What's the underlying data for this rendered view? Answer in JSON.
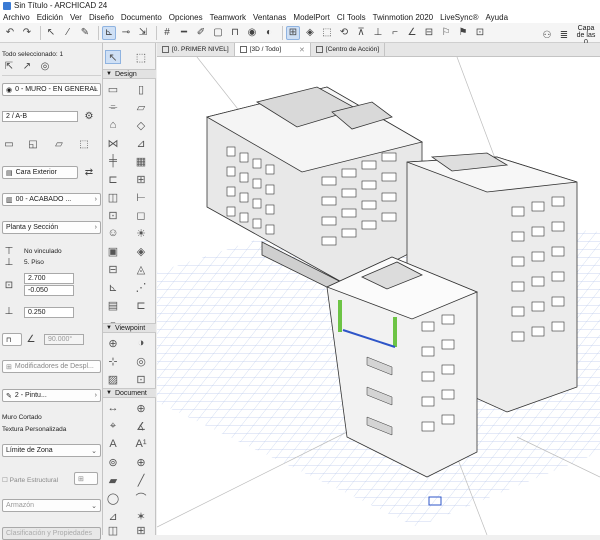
{
  "title": "Sin Título - ARCHICAD 24",
  "menu": [
    "Archivo",
    "Edición",
    "Ver",
    "Diseño",
    "Documento",
    "Opciones",
    "Teamwork",
    "Ventanas",
    "ModelPort",
    "CI Tools",
    "Twinmotion 2020",
    "LiveSync®",
    "Ayuda"
  ],
  "toolbar": {
    "layer_label": "Capa de las",
    "layer_value": "0"
  },
  "info": {
    "selected_label": "Todo seleccionado: 1",
    "layer": "0 - MURO - EN GENERAL",
    "story_line": "2 / A-B",
    "surface_label": "Cara Exterior",
    "finish": "00 - ACABADO ...",
    "floor_plan": "Planta y Sección",
    "link_top": "No vinculado",
    "link_bottom": "5. Piso",
    "height_value": "2.700",
    "offset_value": "-0.050",
    "thickness_value": "0.250",
    "angle_value": "90.000°",
    "modifiers": "Modificadores de Despl...",
    "pen_value": "2 - Pintu...",
    "cut_label": "Muro Cortado",
    "texture_label": "Textura Personalizada",
    "zone_limit": "Límite de Zona",
    "structural_label": "Parte Estructural",
    "framing_label": "Armazón",
    "bottom_blurred": "Clasificación y Propiedades"
  },
  "toolbox": {
    "design_header": "Design",
    "viewpoint_header": "Viewpoint",
    "document_header": "Document"
  },
  "tabs": [
    {
      "label": "[0. PRIMER NIVEL]",
      "active": false
    },
    {
      "label": "[3D / Todo]",
      "active": true
    },
    {
      "label": "[Centro de Acción]",
      "active": false
    }
  ],
  "colors": {
    "accent": "#3a7bd5",
    "grid": "#8aa4de",
    "highlight_green": "#6dc445",
    "highlight_blue": "#2e55c8"
  }
}
